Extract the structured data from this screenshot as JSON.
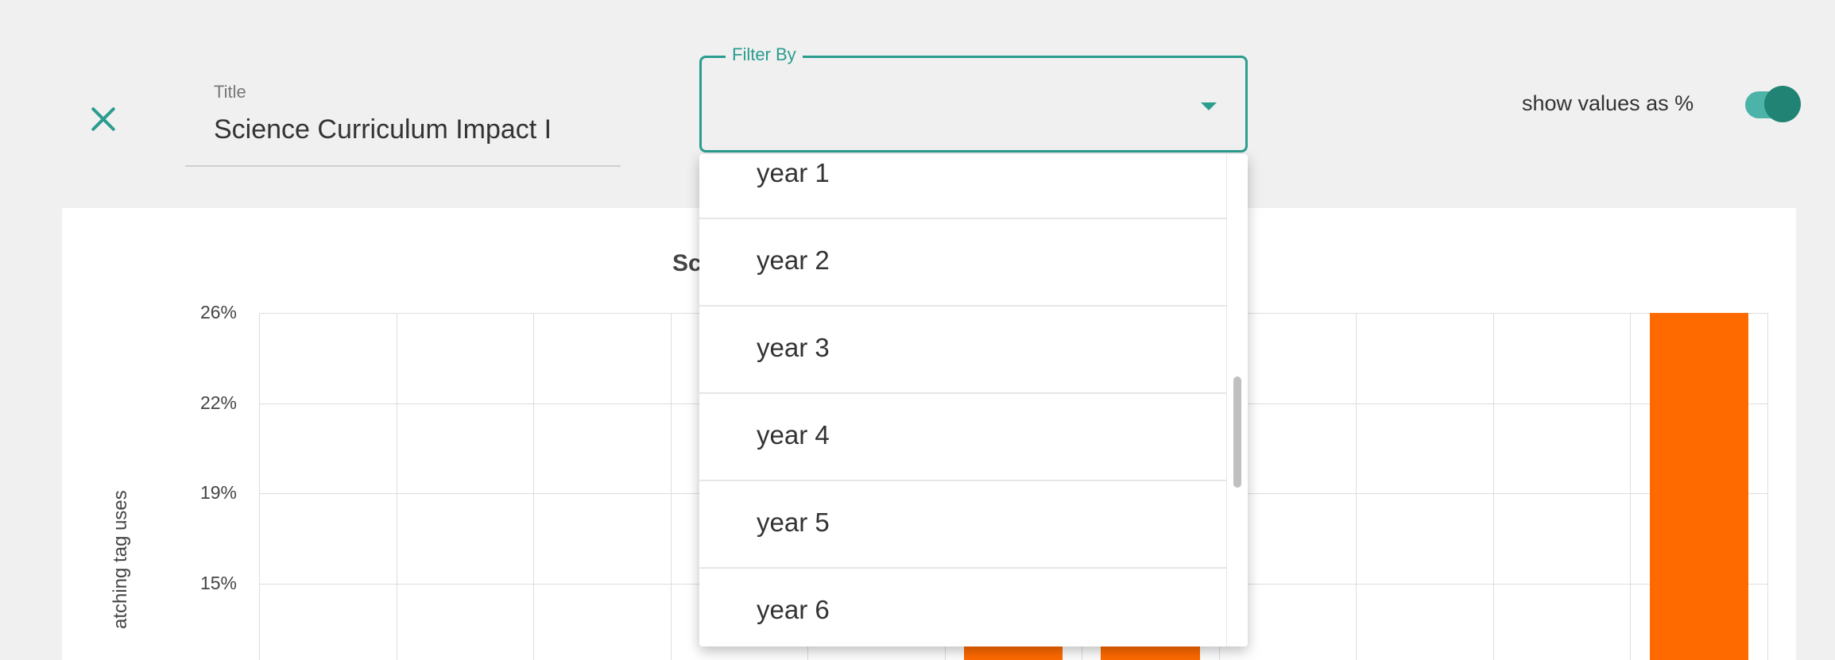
{
  "editor": {
    "close_icon": "close-icon",
    "title_label": "Title",
    "title_value": "Science Curriculum Impact I",
    "filter_label": "Filter By",
    "filter_value": "",
    "toggle_label": "show values as %",
    "toggle_on": true
  },
  "colors": {
    "accent": "#2a9d8f",
    "bar": "#ff6a00",
    "background": "#f0f0f0",
    "card": "#ffffff"
  },
  "dropdown": {
    "options": [
      "year 1",
      "year 2",
      "year 3",
      "year 4",
      "year 5",
      "year 6"
    ]
  },
  "chart_data": {
    "type": "bar",
    "title": "Sc",
    "ylabel": "atching tag uses",
    "ytick_labels": [
      "26%",
      "22%",
      "19%",
      "15%"
    ],
    "ylim": [
      11,
      26
    ],
    "series": [
      {
        "values": [
          null,
          null,
          null,
          null,
          null,
          12,
          12,
          null,
          null,
          null,
          26
        ]
      }
    ]
  }
}
